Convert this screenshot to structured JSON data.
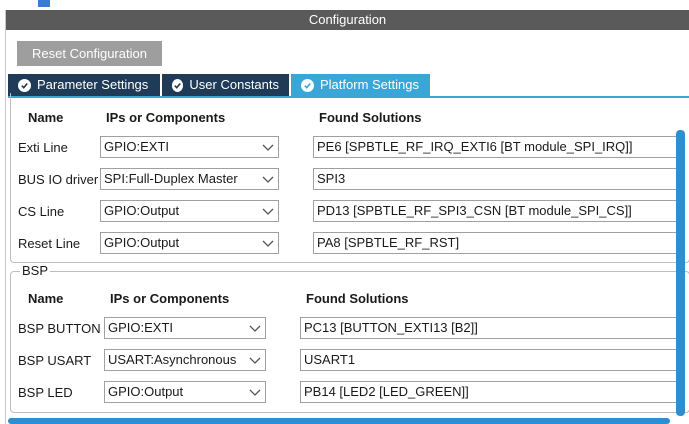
{
  "window": {
    "title": "Configuration"
  },
  "toolbar": {
    "reset_label": "Reset Configuration"
  },
  "tabs": [
    {
      "label": "Parameter Settings",
      "active": false
    },
    {
      "label": "User Constants",
      "active": false
    },
    {
      "label": "Platform Settings",
      "active": true
    }
  ],
  "platform": {
    "headers": {
      "name": "Name",
      "ips": "IPs or Components",
      "solutions": "Found Solutions"
    },
    "rows": [
      {
        "name": "Exti Line",
        "ip": "GPIO:EXTI",
        "solution": "PE6 [SPBTLE_RF_IRQ_EXTI6 [BT module_SPI_IRQ]]"
      },
      {
        "name": "BUS IO driver",
        "ip": "SPI:Full-Duplex Master",
        "solution": "SPI3"
      },
      {
        "name": "CS Line",
        "ip": "GPIO:Output",
        "solution": "PD13 [SPBTLE_RF_SPI3_CSN [BT module_SPI_CS]]"
      },
      {
        "name": "Reset Line",
        "ip": "GPIO:Output",
        "solution": "PA8 [SPBTLE_RF_RST]"
      }
    ]
  },
  "bsp": {
    "legend": "BSP",
    "headers": {
      "name": "Name",
      "ips": "IPs or Components",
      "solutions": "Found Solutions"
    },
    "rows": [
      {
        "name": "BSP BUTTON",
        "ip": "GPIO:EXTI",
        "solution": "PC13 [BUTTON_EXTI13 [B2]]"
      },
      {
        "name": "BSP USART",
        "ip": "USART:Asynchronous",
        "solution": "USART1"
      },
      {
        "name": "BSP LED",
        "ip": "GPIO:Output",
        "solution": "PB14 [LED2 [LED_GREEN]]"
      }
    ]
  },
  "colors": {
    "titlebar": "#5a5a5a",
    "tab": "#1f3b57",
    "tab_active": "#3aa6d8",
    "scrollbar": "#2d8fd0",
    "button": "#9e9e9e"
  }
}
